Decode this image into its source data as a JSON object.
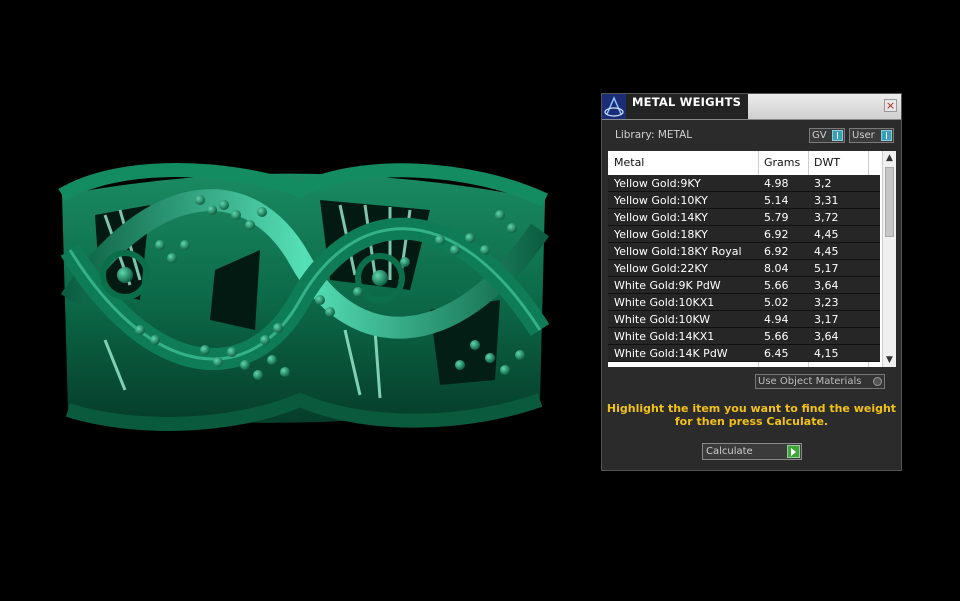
{
  "window": {
    "title": "METAL WEIGHTS",
    "close": "×"
  },
  "library": {
    "label": "Library: METAL"
  },
  "toggles": {
    "gv": "GV",
    "user": "User"
  },
  "table": {
    "headers": [
      "Metal",
      "Grams",
      "DWT"
    ],
    "rows": [
      [
        "Yellow Gold:9KY",
        "4.98",
        "3,2"
      ],
      [
        "Yellow Gold:10KY",
        "5.14",
        "3,31"
      ],
      [
        "Yellow Gold:14KY",
        "5.79",
        "3,72"
      ],
      [
        "Yellow Gold:18KY",
        "6.92",
        "4,45"
      ],
      [
        "Yellow Gold:18KY Royal",
        "6.92",
        "4,45"
      ],
      [
        "Yellow Gold:22KY",
        "8.04",
        "5,17"
      ],
      [
        "White Gold:9K PdW",
        "5.66",
        "3,64"
      ],
      [
        "White Gold:10KX1",
        "5.02",
        "3,23"
      ],
      [
        "White Gold:10KW",
        "4.94",
        "3,17"
      ],
      [
        "White Gold:14KX1",
        "5.66",
        "3,64"
      ],
      [
        "White Gold:14K PdW",
        "6.45",
        "4,15"
      ]
    ]
  },
  "use_object_materials": "Use Object Materials",
  "instructions": {
    "line1": "Highlight the item you want to find the weight",
    "line2": "for then press Calculate."
  },
  "calculate_label": "Calculate",
  "colors": {
    "ring": "#0d6e4c",
    "accent": "#f2c21a",
    "highlight": "#4fd6ac"
  },
  "icons": {
    "app": "cad-logo-icon",
    "calculate": "play-arrow-icon"
  }
}
